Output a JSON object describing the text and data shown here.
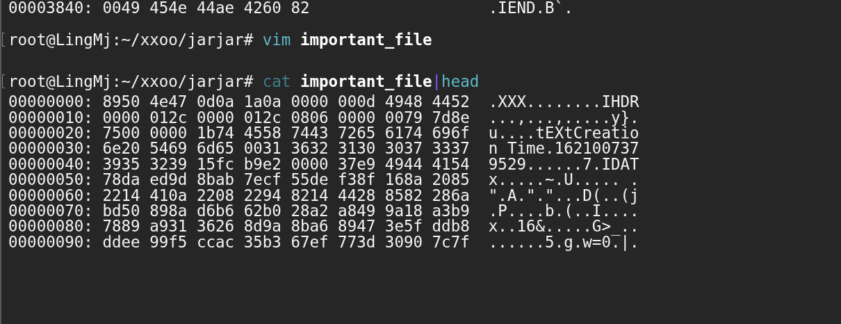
{
  "terminal": {
    "previous_output": {
      "offset": "00003840:",
      "hex": "0049 454e 44ae 4260 82",
      "ascii": ".IEND.B`."
    },
    "commands": [
      {
        "prompt": "root@LingMj:~/xxoo/jarjar#",
        "tokens": [
          {
            "kind": "command",
            "text": "vim",
            "dimmed": false
          },
          {
            "kind": "argument",
            "text": "important_file",
            "dimmed": false
          }
        ]
      },
      {
        "prompt": "root@LingMj:~/xxoo/jarjar#",
        "tokens": [
          {
            "kind": "command",
            "text": "cat",
            "dimmed": true
          },
          {
            "kind": "argument",
            "text": "important_file",
            "dimmed": false
          },
          {
            "kind": "pipe",
            "text": "|",
            "dimmed": false
          },
          {
            "kind": "command",
            "text": "head",
            "dimmed": false
          }
        ]
      }
    ],
    "hex_rows": [
      {
        "offset": "00000000:",
        "hex": "8950 4e47 0d0a 1a0a 0000 000d 4948 4452",
        "ascii": ".XXX........IHDR"
      },
      {
        "offset": "00000010:",
        "hex": "0000 012c 0000 012c 0806 0000 0079 7d8e",
        "ascii": "...,...,.....y}."
      },
      {
        "offset": "00000020:",
        "hex": "7500 0000 1b74 4558 7443 7265 6174 696f",
        "ascii": "u....tEXtCreatio"
      },
      {
        "offset": "00000030:",
        "hex": "6e20 5469 6d65 0031 3632 3130 3037 3337",
        "ascii": "n Time.162100737"
      },
      {
        "offset": "00000040:",
        "hex": "3935 3239 15fc b9e2 0000 37e9 4944 4154",
        "ascii": "9529......7.IDAT"
      },
      {
        "offset": "00000050:",
        "hex": "78da ed9d 8bab 7ecf 55de f38f 168a 2085",
        "ascii": "x.....~.U..... ."
      },
      {
        "offset": "00000060:",
        "hex": "2214 410a 2208 2294 8214 4428 8582 286a",
        "ascii": "\".A.\".\"...D(..(j"
      },
      {
        "offset": "00000070:",
        "hex": "bd50 898a d6b6 62b0 28a2 a849 9a18 a3b9",
        "ascii": ".P....b.(..I...."
      },
      {
        "offset": "00000080:",
        "hex": "7889 a931 3626 8d9a 8ba6 8947 3e5f ddb8",
        "ascii": "x..16&.....G>_.."
      },
      {
        "offset": "00000090:",
        "hex": "ddee 99f5 ccac 35b3 67ef 773d 3090 7c7f",
        "ascii": "......5.g.w=0.|."
      }
    ]
  }
}
